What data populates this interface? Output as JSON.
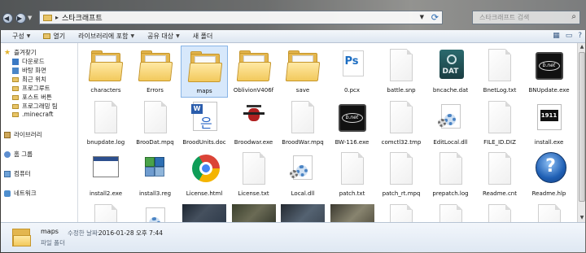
{
  "address": {
    "crumb": "스타크래프트",
    "search_placeholder": "스타크래프트 검색"
  },
  "toolbar": {
    "organize": "구성",
    "open": "열기",
    "include_library": "라이브러리에 포함",
    "share": "공유 대상",
    "new_folder": "새 폴더"
  },
  "nav": {
    "favorites": "즐겨찾기",
    "downloads": "다운로드",
    "desktop": "바탕 화면",
    "recent": "최근 위치",
    "program_root": "프로그루트",
    "post_version": "포스트 버튼",
    "programming": "프로그래밍 팀",
    "minecraft": ".minecraft",
    "libraries": "라이브러리",
    "homegroup": "홈 그룹",
    "computer": "컴퓨터",
    "network": "네트워크"
  },
  "files": [
    {
      "name": "characters",
      "icon": "folder-icon"
    },
    {
      "name": "Errors",
      "icon": "folder-icon"
    },
    {
      "name": "maps",
      "icon": "folder-icon",
      "selected": true
    },
    {
      "name": "OblivionV406f",
      "icon": "folder-icon"
    },
    {
      "name": "save",
      "icon": "folder-icon"
    },
    {
      "name": "0.pcx",
      "icon": "photoshop-icon"
    },
    {
      "name": "battle.snp",
      "icon": "document-icon"
    },
    {
      "name": "bncache.dat",
      "icon": "dat-file-icon"
    },
    {
      "name": "BnetLog.txt",
      "icon": "document-icon"
    },
    {
      "name": "BNUpdate.exe",
      "icon": "battlenet-icon"
    },
    {
      "name": "bnupdate.log",
      "icon": "document-icon"
    },
    {
      "name": "BrooDat.mpq",
      "icon": "document-icon"
    },
    {
      "name": "BroodUnits.doc",
      "icon": "word-document-icon"
    },
    {
      "name": "Broodwar.exe",
      "icon": "zerg-icon"
    },
    {
      "name": "BroodWar.mpq",
      "icon": "document-icon"
    },
    {
      "name": "BW-116.exe",
      "icon": "battlenet-icon"
    },
    {
      "name": "comctl32.tmp",
      "icon": "document-icon"
    },
    {
      "name": "EditLocal.dll",
      "icon": "gear-file-icon"
    },
    {
      "name": "FILE_ID.DIZ",
      "icon": "document-icon"
    },
    {
      "name": "install.exe",
      "icon": "install-1911-icon"
    },
    {
      "name": "install2.exe",
      "icon": "window-exe-icon"
    },
    {
      "name": "install3.reg",
      "icon": "registry-icon"
    },
    {
      "name": "License.html",
      "icon": "chrome-icon"
    },
    {
      "name": "License.txt",
      "icon": "document-icon"
    },
    {
      "name": "Local.dll",
      "icon": "gear-file-icon"
    },
    {
      "name": "patch.txt",
      "icon": "document-icon"
    },
    {
      "name": "patch_rt.mpq",
      "icon": "document-icon"
    },
    {
      "name": "prepatch.log",
      "icon": "document-icon"
    },
    {
      "name": "Readme.cnt",
      "icon": "document-icon"
    },
    {
      "name": "Readme.hlp",
      "icon": "help-icon"
    }
  ],
  "partial_row": [
    "document-icon",
    "gear-file-icon",
    "image-thumb-icon",
    "image-thumb-icon",
    "image-thumb-icon",
    "image-thumb-icon",
    "document-icon",
    "document-icon",
    "document-icon",
    "document-icon"
  ],
  "details": {
    "name": "maps",
    "type": "파일 폴더",
    "modified_label": "수정한 날짜:",
    "modified_value": "2016-01-28 오후 7:44"
  },
  "colors": {
    "accent": "#2c6bb2",
    "selection": "#d7e8fb",
    "folder": "#e3b64f"
  }
}
